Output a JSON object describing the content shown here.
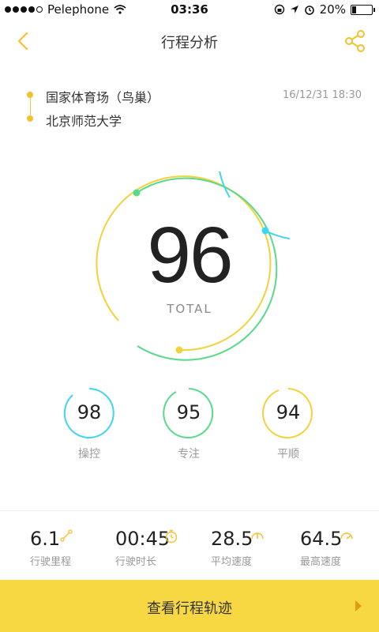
{
  "status_bar": {
    "carrier": "Pelephone",
    "time": "03:36",
    "battery": "20%"
  },
  "header": {
    "title": "行程分析"
  },
  "route": {
    "start": "国家体育场（鸟巢）",
    "end": "北京师范大学",
    "datetime": "16/12/31 18:30"
  },
  "score": {
    "value": "96",
    "label": "TOTAL"
  },
  "metrics": [
    {
      "value": "98",
      "label": "操控",
      "color": "#3dd6f0"
    },
    {
      "value": "95",
      "label": "专注",
      "color": "#5ad98a"
    },
    {
      "value": "94",
      "label": "平顺",
      "color": "#f2d23a"
    }
  ],
  "stats": [
    {
      "value": "6.1",
      "label": "行驶里程",
      "icon": "route-icon"
    },
    {
      "value": "00:45",
      "label": "行驶时长",
      "icon": "timer-icon"
    },
    {
      "value": "28.5",
      "label": "平均速度",
      "icon": "speedometer-icon"
    },
    {
      "value": "64.5",
      "label": "最高速度",
      "icon": "speedometer-max-icon"
    }
  ],
  "bottom": {
    "label": "查看行程轨迹"
  },
  "colors": {
    "accent": "#f2c12e",
    "cyan": "#3dd6f0",
    "green": "#5ad98a",
    "yellow": "#f2d23a"
  }
}
